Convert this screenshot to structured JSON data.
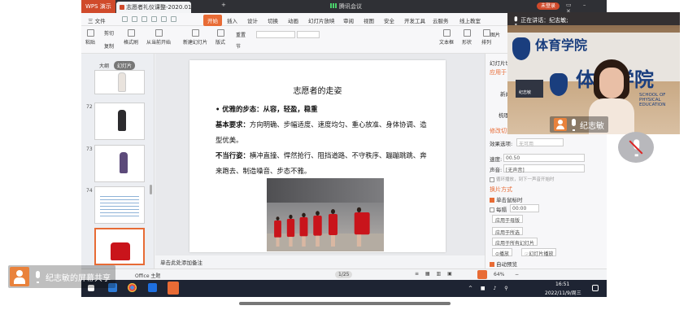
{
  "titlebar": {
    "app_name": "WPS 演示",
    "doc_tab": "志愿者礼仪课整-2020.01.13",
    "meeting_label": "腾讯会议",
    "login_label": "未登录"
  },
  "menubar": {
    "file": "三 文件",
    "tabs": [
      "开始",
      "插入",
      "设计",
      "切换",
      "动画",
      "幻灯片放映",
      "审阅",
      "视图",
      "安全",
      "开发工具",
      "云服务",
      "线上教室"
    ]
  },
  "ribbon": {
    "paste": "粘贴",
    "cut": "剪切",
    "copy": "复制",
    "format_painter": "格式刷",
    "play_from_current": "从当前开始",
    "new_slide": "新建幻灯片",
    "layout": "版式",
    "section": "节",
    "reset": "重置",
    "textbox": "文本框",
    "shape": "形状",
    "picture": "图片",
    "arrange": "排列"
  },
  "left_panel": {
    "tab_outline": "大纲",
    "tab_slides": "幻灯片",
    "slide_numbers": [
      "72",
      "73",
      "74"
    ]
  },
  "slide": {
    "title": "志愿者的走姿",
    "bullet": "优雅的步态：从容，轻盈，稳重",
    "basic_label": "基本要求：",
    "basic_text": "方向明确、步幅适度、速度均匀、重心放准、身体协调、造型优美。",
    "bad_label": "不当行姿：",
    "bad_text": "横冲直撞、悍然抢行、阻挡道路、不守秩序、蹦蹦跳跳、奔来跑去、制造噪音、步态不雅。"
  },
  "notes": {
    "placeholder": "单击此处添加备注"
  },
  "statusbar": {
    "page": "1/25",
    "theme": "Office 主题",
    "zoom": "64%"
  },
  "right_panel": {
    "header": "幻灯片切换",
    "apply_label": "应用于",
    "effects": [
      "新闻快报",
      "轮辐",
      "梳理",
      "抽出"
    ],
    "modify_section": "修改切换效果",
    "effect_option_label": "效果选项:",
    "effect_option_value": "无可用",
    "speed_label": "速度:",
    "speed_value": "00.50",
    "sound_label": "声音:",
    "sound_value": "[无声音]",
    "loop_label": "循环播放，到下一声音开始时",
    "advance_section": "换片方式",
    "on_click": "单击鼠标时",
    "every_label": "每隔",
    "every_value": "00:00",
    "apply_master": "应用于母版",
    "apply_selected": "应用于所选",
    "apply_all": "应用于所有幻灯片",
    "play": "播放",
    "slideshow": "幻灯片播放",
    "autopreview": "自动预览"
  },
  "taskbar": {
    "time": "16:51",
    "date": "2022/11/9/周三"
  },
  "video": {
    "speaking_label": "正在讲话：纪志敏;",
    "school_cn": "体育学院",
    "school_cn_big": "体育学院",
    "school_en": "SCHOOL OF PHYSICAL EDUCATION",
    "mini_name": "纪志敏",
    "speaker_name": "纪志敏"
  },
  "screen_share": {
    "label": "纪志敏的屏幕共享"
  }
}
